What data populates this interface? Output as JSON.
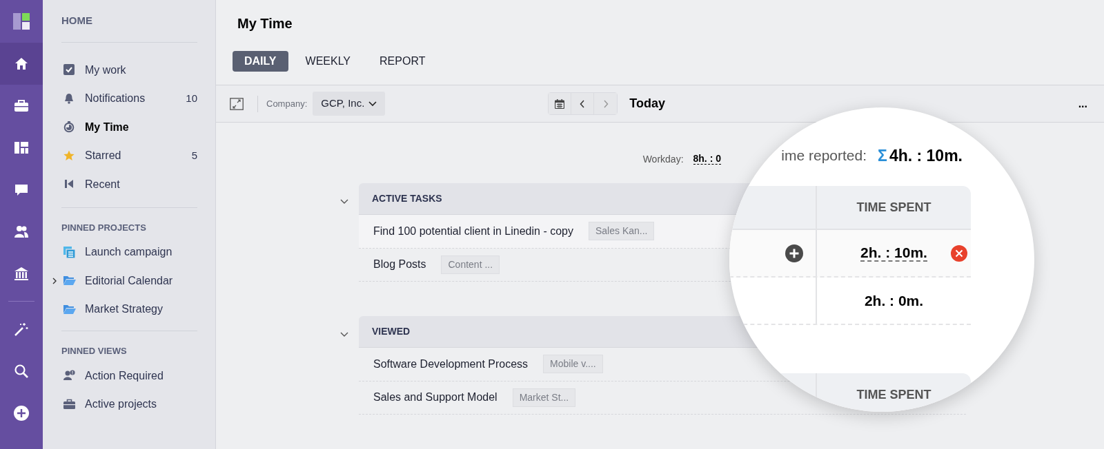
{
  "rail": {
    "items": [
      {
        "kind": "home",
        "selected": true
      },
      {
        "kind": "briefcase",
        "selected": false
      },
      {
        "kind": "dashboard",
        "selected": false
      },
      {
        "kind": "chat",
        "selected": false
      },
      {
        "kind": "people",
        "selected": false
      },
      {
        "kind": "bank",
        "selected": false
      },
      {
        "kind": "wand",
        "selected": false
      },
      {
        "kind": "search",
        "selected": false
      },
      {
        "kind": "add",
        "selected": false
      }
    ]
  },
  "sidebar": {
    "title": "HOME",
    "items": [
      {
        "label": "My work",
        "kind": "check",
        "selected": false
      },
      {
        "label": "Notifications",
        "kind": "bell",
        "count": "10",
        "selected": false
      },
      {
        "label": "My Time",
        "kind": "timer",
        "selected": true
      },
      {
        "label": "Starred",
        "kind": "star",
        "count": "5",
        "selected": false
      },
      {
        "label": "Recent",
        "kind": "recent",
        "selected": false
      }
    ],
    "sections": [
      {
        "title": "PINNED PROJECTS",
        "items": [
          {
            "label": "Launch campaign",
            "kind": "project"
          },
          {
            "label": "Editorial Calendar",
            "kind": "folder",
            "expanded": false
          },
          {
            "label": "Market Strategy",
            "kind": "folder"
          }
        ]
      },
      {
        "title": "PINNED VIEWS",
        "items": [
          {
            "label": "Action Required",
            "kind": "person-alert"
          },
          {
            "label": "Active projects",
            "kind": "briefcase"
          }
        ]
      }
    ]
  },
  "page": {
    "title": "My Time",
    "tabs": [
      {
        "label": "DAILY",
        "selected": true
      },
      {
        "label": "WEEKLY",
        "selected": false
      },
      {
        "label": "REPORT",
        "selected": false
      }
    ],
    "toolbar": {
      "company_label": "Company:",
      "company": "GCP, Inc.",
      "date": "Today",
      "more": "..."
    },
    "workday_label": "Workday:",
    "workday": "8h. : 0",
    "time_reported_label": "ime reported:",
    "sigma": "Σ",
    "time_reported": "4h. : 10m."
  },
  "groups": [
    {
      "title": "ACTIVE TASKS",
      "expanded": true,
      "column": "TIME SPENT",
      "rows": [
        {
          "task": "Find 100 potential client in Linedin - copy",
          "project": "Sales Kan...",
          "time": "2h. : 10m.",
          "editing": true
        },
        {
          "task": "Blog Posts",
          "project": "Content ...",
          "time": "2h. : 0m.",
          "editing": false
        }
      ]
    },
    {
      "title": "VIEWED",
      "expanded": true,
      "column": "TIME SPENT",
      "rows": [
        {
          "task": "Software Development Process",
          "project": "Mobile v...."
        },
        {
          "task": "Sales and Support Model",
          "project": "Market St..."
        }
      ]
    }
  ]
}
